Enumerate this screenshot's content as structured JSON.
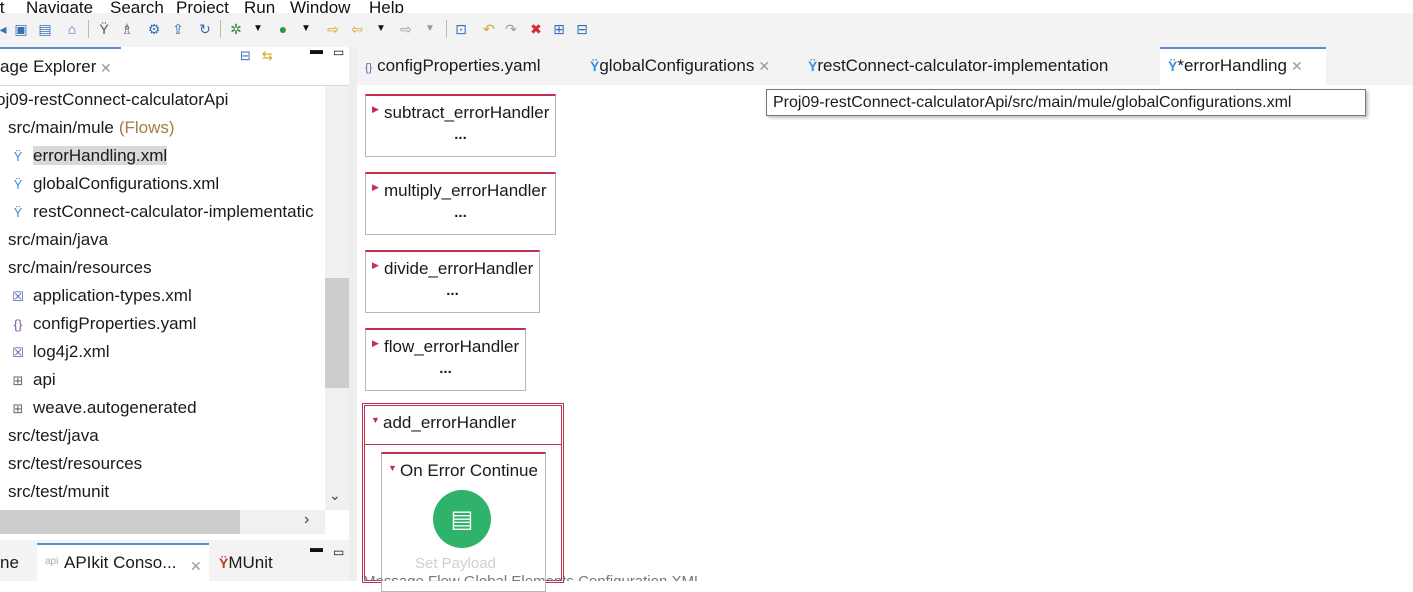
{
  "menu": [
    "it",
    "Navigate",
    "Search",
    "Project",
    "Run",
    "Window",
    "Help"
  ],
  "explorer": {
    "tab_label": "age Explorer",
    "tree": [
      {
        "label": "oj09-restConnect-calculatorApi",
        "suffix": "",
        "icon": "",
        "indent": 0
      },
      {
        "label": "src/main/mule",
        "suffix": "(Flows)",
        "icon": "",
        "indent": 1
      },
      {
        "label": "errorHandling.xml",
        "suffix": "",
        "icon": "mule-icon",
        "indent": 2,
        "selected": true
      },
      {
        "label": "globalConfigurations.xml",
        "suffix": "",
        "icon": "mule-icon",
        "indent": 2
      },
      {
        "label": "restConnect-calculator-implementatic",
        "suffix": "",
        "icon": "mule-icon",
        "indent": 2
      },
      {
        "label": "src/main/java",
        "suffix": "",
        "icon": "",
        "indent": 1
      },
      {
        "label": "src/main/resources",
        "suffix": "",
        "icon": "",
        "indent": 1
      },
      {
        "label": "application-types.xml",
        "suffix": "",
        "icon": "xml-file-icon",
        "indent": 2
      },
      {
        "label": "configProperties.yaml",
        "suffix": "",
        "icon": "yaml-file-icon",
        "indent": 2
      },
      {
        "label": "log4j2.xml",
        "suffix": "",
        "icon": "xml-file-icon",
        "indent": 2
      },
      {
        "label": "api",
        "suffix": "",
        "icon": "folder-icon",
        "indent": 2
      },
      {
        "label": "weave.autogenerated",
        "suffix": "",
        "icon": "folder-icon",
        "indent": 2
      },
      {
        "label": "src/test/java",
        "suffix": "",
        "icon": "",
        "indent": 1
      },
      {
        "label": "src/test/resources",
        "suffix": "",
        "icon": "",
        "indent": 1
      },
      {
        "label": "src/test/munit",
        "suffix": "",
        "icon": "",
        "indent": 1
      }
    ]
  },
  "bottom_tabs": [
    "ne",
    "APIkit Conso...",
    "MUnit"
  ],
  "editor_tabs": [
    {
      "label": "configProperties.yaml",
      "icon": "yaml-file-icon",
      "active": false,
      "closable": false
    },
    {
      "label": "globalConfigurations",
      "icon": "mule-icon",
      "active": false,
      "closable": true
    },
    {
      "label": "restConnect-calculator-implementation",
      "icon": "mule-icon",
      "active": false,
      "closable": false
    },
    {
      "label": "*errorHandling",
      "icon": "mule-icon",
      "active": true,
      "closable": true
    }
  ],
  "tooltip": "Proj09-restConnect-calculatorApi/src/main/mule/globalConfigurations.xml",
  "handlers": [
    {
      "label": "subtract_errorHandler",
      "dots": "..."
    },
    {
      "label": "multiply_errorHandler",
      "dots": "..."
    },
    {
      "label": "divide_errorHandler",
      "dots": "..."
    },
    {
      "label": "flow_errorHandler",
      "dots": "..."
    }
  ],
  "expanded_handler": {
    "label": "add_errorHandler",
    "inner": "On Error Continue",
    "component": "Set Payload"
  },
  "status_tabs": "Message Flow  Global Elements  Configuration XML",
  "colors": {
    "accent": "#5b8ed0",
    "handler_border": "#c2304f",
    "component_green": "#2fb36b",
    "mule_blue": "#3d8fd8"
  }
}
